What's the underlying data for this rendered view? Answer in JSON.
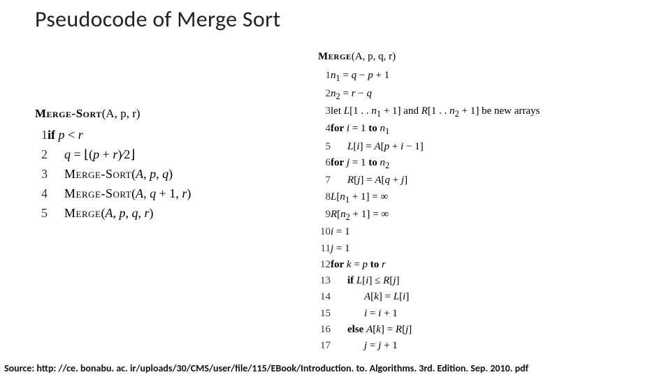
{
  "title": "Pseudocode of Merge Sort",
  "left": {
    "header_name": "Merge-Sort",
    "header_args": "(A, p, r)",
    "lines": [
      {
        "n": "1",
        "html": "<span class='kw'>if</span> <i>p</i> &lt; <i>r</i>"
      },
      {
        "n": "2",
        "html": "<span class='i1'><i>q</i> = ⌊(<i>p</i> + <i>r</i>)∕2⌋</span>"
      },
      {
        "n": "3",
        "html": "<span class='i1'><span class='sc'>Merge-Sort</span>(<i>A</i>, <i>p</i>, <i>q</i>)</span>"
      },
      {
        "n": "4",
        "html": "<span class='i1'><span class='sc'>Merge-Sort</span>(<i>A</i>, <i>q</i> + 1, <i>r</i>)</span>"
      },
      {
        "n": "5",
        "html": "<span class='i1'><span class='sc'>Merge</span>(<i>A</i>, <i>p</i>, <i>q</i>, <i>r</i>)</span>"
      }
    ]
  },
  "right": {
    "header_name": "Merge",
    "header_args": "(A, p, q, r)",
    "lines": [
      {
        "n": "1",
        "html": "<i>n</i><sub>1</sub> = <i>q</i> − <i>p</i> + 1"
      },
      {
        "n": "2",
        "html": "<i>n</i><sub>2</sub> = <i>r</i> − <i>q</i>"
      },
      {
        "n": "3",
        "html": "let <i>L</i>[1 . . <i>n</i><sub>1</sub> + 1] and <i>R</i>[1 . . <i>n</i><sub>2</sub> + 1] be new arrays"
      },
      {
        "n": "4",
        "html": "<span class='kw'>for</span> <i>i</i> = 1 <span class='kw'>to</span> <i>n</i><sub>1</sub>"
      },
      {
        "n": "5",
        "html": "<span class='i1'><i>L</i>[<i>i</i>] = <i>A</i>[<i>p</i> + <i>i</i> − 1]</span>"
      },
      {
        "n": "6",
        "html": "<span class='kw'>for</span> <i>j</i> = 1 <span class='kw'>to</span> <i>n</i><sub>2</sub>"
      },
      {
        "n": "7",
        "html": "<span class='i1'><i>R</i>[<i>j</i>] = <i>A</i>[<i>q</i> + <i>j</i>]</span>"
      },
      {
        "n": "8",
        "html": "<i>L</i>[<i>n</i><sub>1</sub> + 1] = ∞"
      },
      {
        "n": "9",
        "html": "<i>R</i>[<i>n</i><sub>2</sub> + 1] = ∞"
      },
      {
        "n": "10",
        "html": "<i>i</i> = 1"
      },
      {
        "n": "11",
        "html": "<i>j</i> = 1"
      },
      {
        "n": "12",
        "html": "<span class='kw'>for</span> <i>k</i> = <i>p</i> <span class='kw'>to</span> <i>r</i>"
      },
      {
        "n": "13",
        "html": "<span class='i1'><span class='kw'>if</span> <i>L</i>[<i>i</i>] ≤ <i>R</i>[<i>j</i>]</span>"
      },
      {
        "n": "14",
        "html": "<span class='i2'><i>A</i>[<i>k</i>] = <i>L</i>[<i>i</i>]</span>"
      },
      {
        "n": "15",
        "html": "<span class='i2'><i>i</i> = <i>i</i> + 1</span>"
      },
      {
        "n": "16",
        "html": "<span class='i1'><span class='kw'>else</span> <i>A</i>[<i>k</i>] = <i>R</i>[<i>j</i>]</span>"
      },
      {
        "n": "17",
        "html": "<span class='i2'><i>j</i> = <i>j</i> + 1</span>"
      }
    ]
  },
  "source": "Source: http: //ce. bonabu. ac. ir/uploads/30/CMS/user/file/115/EBook/Introduction. to. Algorithms. 3rd. Edition. Sep. 2010. pdf"
}
